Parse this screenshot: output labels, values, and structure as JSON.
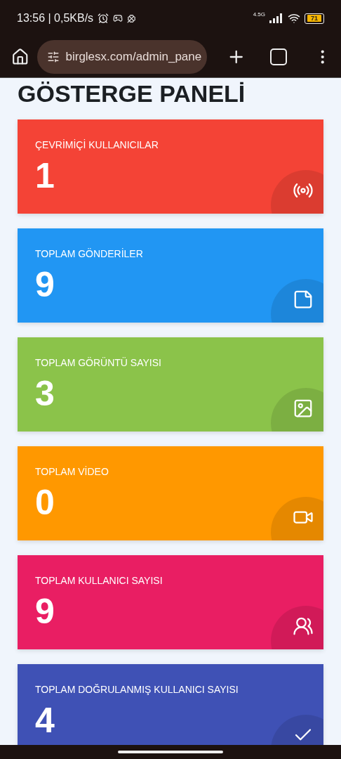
{
  "status_bar": {
    "time": "13:56 | 0,5KB/s",
    "network": "4.5G",
    "battery": "71"
  },
  "browser": {
    "url": "birglesx.com/admin_pane"
  },
  "heading": "GÖSTERGE PANELİ",
  "cards": [
    {
      "kind": "online",
      "label": "ÇEVRİMİÇİ KULLANICILAR",
      "value": "1",
      "color": "#f44336"
    },
    {
      "kind": "posts",
      "label": "TOPLAM GÖNDERİLER",
      "value": "9",
      "color": "#2196f3"
    },
    {
      "kind": "images",
      "label": "TOPLAM GÖRÜNTÜ SAYISI",
      "value": "3",
      "color": "#8bc34a"
    },
    {
      "kind": "video",
      "label": "TOPLAM VİDEO",
      "value": "0",
      "color": "#ff9800"
    },
    {
      "kind": "users",
      "label": "TOPLAM KULLANICI SAYISI",
      "value": "9",
      "color": "#e91e63"
    },
    {
      "kind": "verified",
      "label": "TOPLAM DOĞRULANMIŞ KULLANICI SAYISI",
      "value": "4",
      "color": "#3f51b5"
    }
  ]
}
